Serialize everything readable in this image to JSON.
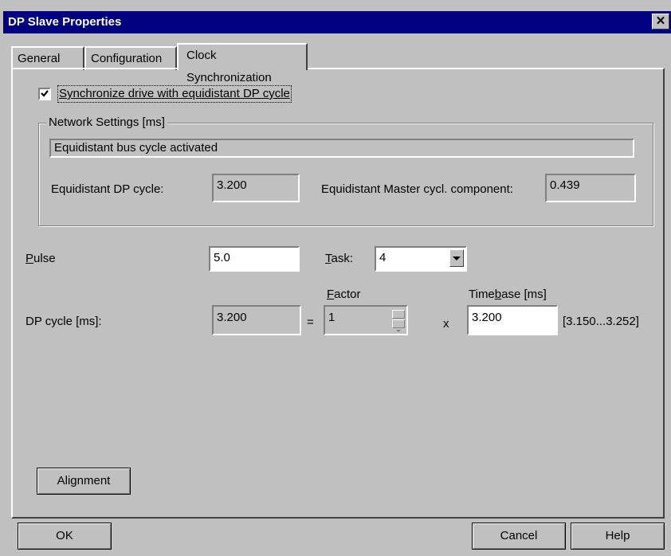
{
  "window": {
    "title": "DP Slave Properties",
    "close_glyph": "✕"
  },
  "tabs": [
    {
      "label": "General",
      "active": false
    },
    {
      "label": "Configuration",
      "active": false
    },
    {
      "label": "Clock Synchronization",
      "active": true
    }
  ],
  "sync_checkbox": {
    "label": "Synchronize drive with equidistant DP cycle",
    "checked": true
  },
  "network_settings": {
    "group_label": "Network Settings [ms]",
    "status_text": "Equidistant bus cycle activated",
    "dp_cycle_label": "Equidistant DP cycle:",
    "dp_cycle_value": "3.200",
    "master_component_label": "Equidistant Master cycl. component:",
    "master_component_value": "0.439"
  },
  "pulse": {
    "label_underlined": "P",
    "label_rest": "ulse",
    "value": "5.0"
  },
  "task": {
    "label_underlined": "T",
    "label_rest": "ask:",
    "value": "4"
  },
  "factor": {
    "label_underlined": "F",
    "label_rest": "actor",
    "value": "1"
  },
  "timebase": {
    "label_pre": "Time",
    "label_underlined": "b",
    "label_rest": "ase [ms]",
    "value": "3.200",
    "range": "[3.150...3.252]"
  },
  "dp_cycle": {
    "label": "DP cycle [ms]:",
    "value": "3.200",
    "equals": "=",
    "times": "x"
  },
  "buttons": {
    "alignment": "Alignment",
    "ok": "OK",
    "cancel": "Cancel",
    "help": "Help"
  },
  "colors": {
    "titlebar": "#000080",
    "dialog": "#c0c0c0"
  }
}
